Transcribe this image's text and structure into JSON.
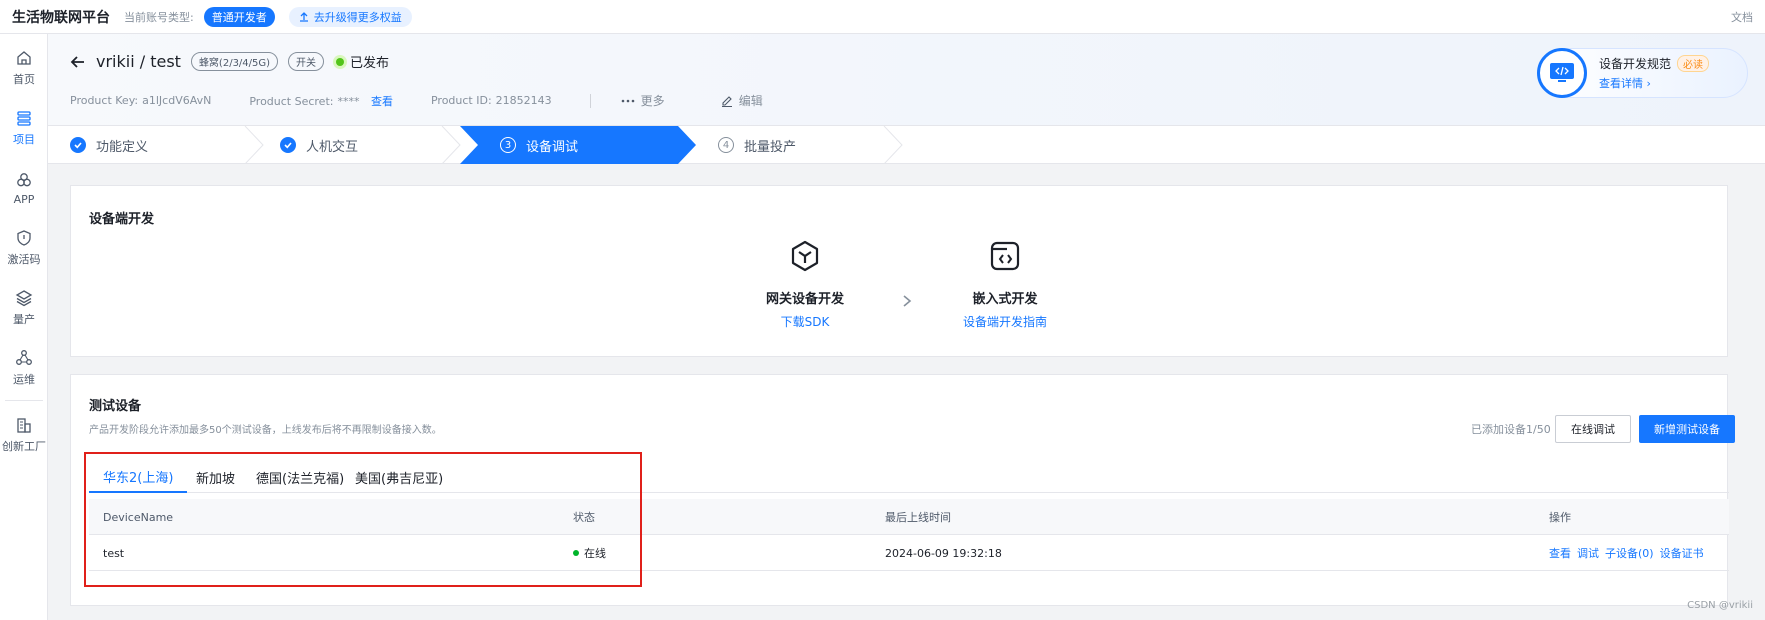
{
  "topbar": {
    "brand": "生活物联网平台",
    "account_label": "当前账号类型:",
    "account_type": "普通开发者",
    "upgrade_label": "去升级得更多权益",
    "docs_label": "文档"
  },
  "sidenav": {
    "items": [
      {
        "label": "首页",
        "icon": "home-icon"
      },
      {
        "label": "项目",
        "icon": "list-icon"
      },
      {
        "label": "APP",
        "icon": "app-icon"
      },
      {
        "label": "激活码",
        "icon": "shield-icon"
      },
      {
        "label": "量产",
        "icon": "layers-icon"
      },
      {
        "label": "运维",
        "icon": "nodes-icon"
      },
      {
        "label": "创新工厂",
        "icon": "building-icon"
      }
    ]
  },
  "header": {
    "title": "vrikii / test",
    "network_tag": "蜂窝(2/3/4/5G)",
    "type_tag": "开关",
    "status": "已发布",
    "product_key_label": "Product Key:",
    "product_key": "a1lJcdV6AvN",
    "product_secret_label": "Product Secret:",
    "product_secret": "****",
    "view_label": "查看",
    "product_id_label": "Product ID:",
    "product_id": "21852143",
    "more_label": "更多",
    "edit_label": "编辑"
  },
  "promo": {
    "title": "设备开发规范",
    "badge": "必读",
    "link": "查看详情"
  },
  "steps": [
    {
      "num": "",
      "label": "功能定义",
      "state": "done"
    },
    {
      "num": "",
      "label": "人机交互",
      "state": "done"
    },
    {
      "num": "3",
      "label": "设备调试",
      "state": "current"
    },
    {
      "num": "4",
      "label": "批量投产",
      "state": "todo"
    }
  ],
  "device_dev": {
    "title": "设备端开发",
    "gateway_title": "网关设备开发",
    "gateway_link": "下载SDK",
    "embedded_title": "嵌入式开发",
    "embedded_link": "设备端开发指南"
  },
  "test_devices": {
    "title": "测试设备",
    "description": "产品开发阶段允许添加最多50个测试设备，上线发布后将不再限制设备接入数。",
    "added_count": "已添加设备1/50",
    "online_debug_label": "在线调试",
    "add_device_label": "新增测试设备",
    "tabs": [
      "华东2(上海)",
      "新加坡",
      "德国(法兰克福)",
      "美国(弗吉尼亚)"
    ],
    "columns": [
      "DeviceName",
      "状态",
      "最后上线时间",
      "操作"
    ],
    "rows": [
      {
        "name": "test",
        "status": "在线",
        "last_online": "2024-06-09 19:32:18",
        "actions": [
          "查看",
          "调试",
          "子设备(0)",
          "设备证书"
        ]
      }
    ]
  },
  "watermark": "CSDN @vrikii",
  "colors": {
    "accent": "#1677ff",
    "online": "#00b42a",
    "highlight": "#e0201a"
  }
}
